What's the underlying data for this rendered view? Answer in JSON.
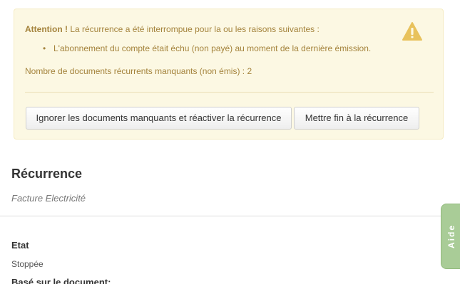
{
  "alert": {
    "title_strong": "Attention !",
    "title_text": " La récurrence a été interrompue pour la ou les raisons suivantes :",
    "reasons": [
      "L'abonnement du compte était échu (non payé) au moment de la dernière émission."
    ],
    "missing_count_text": "Nombre de documents récurrents manquants (non émis) : 2",
    "icon": "warning-triangle-icon",
    "color": "#a4833c",
    "background": "#fcf8e3"
  },
  "actions": {
    "ignore_label": "Ignorer les documents manquants et réactiver la récurrence",
    "end_label": "Mettre fin à la récurrence"
  },
  "section": {
    "title": "Récurrence",
    "subtitle": "Facture Electricité"
  },
  "fields": [
    {
      "label": "Etat",
      "value": "Stoppée"
    },
    {
      "label": "Basé sur le document:"
    }
  ],
  "help_tab": {
    "label": "Aide",
    "color": "#a9cc97"
  }
}
